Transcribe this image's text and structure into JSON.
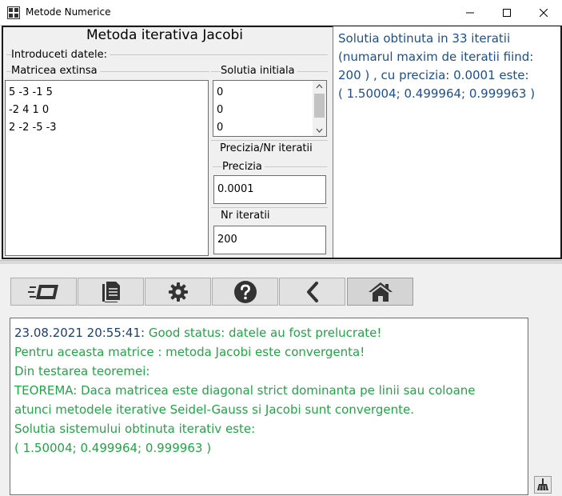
{
  "window": {
    "title": "Metode Numerice",
    "icon": "app-grid-icon"
  },
  "form": {
    "title": "Metoda iterativa Jacobi",
    "intro_label": "Introduceti datele:",
    "matrix_group": "Matricea extinsa",
    "matrix_lines": [
      "5 -3 -1 5",
      "-2 4 1 0",
      "2 -2 -5 -3"
    ],
    "initial_group": "Solutia initiala",
    "initial_values": [
      "0",
      "0",
      "0"
    ],
    "precision_group": "Precizia/Nr iteratii",
    "precision_label": "Precizia",
    "precision_value": "0.0001",
    "iterations_label": "Nr iteratii",
    "iterations_value": "200"
  },
  "result": {
    "lines": [
      "Solutia obtinuta in 33 iteratii",
      "(numarul maxim de iteratii fiind:",
      "200 ) , cu precizia: 0.0001 este:",
      "( 1.50004; 0.499964; 0.999963 )"
    ],
    "color": "#1e4f8c"
  },
  "toolbar": {
    "buttons": [
      "input-card-icon",
      "document-icon",
      "settings-gear-icon",
      "help-icon",
      "back-chevron-icon",
      "home-icon"
    ],
    "selected": "home-icon"
  },
  "log": {
    "timestamp": "23.08.2021 20:55:41:",
    "first_message": " Good status: datele au fost prelucrate!",
    "lines": [
      "Pentru aceasta matrice : metoda Jacobi este convergenta!",
      "Din testarea teoremei:",
      "TEOREMA: Daca matricea este diagonal strict dominanta pe linii sau coloane",
      "atunci metodele iterative Seidel-Gauss si Jacobi sunt convergente.",
      "Solutia sistemului obtinuta iterativ este:",
      "( 1.50004; 0.499964; 0.999963 )"
    ],
    "timestamp_color": "#1e3f6e",
    "message_color": "#22a546"
  },
  "clear_icon": "broom-clear-icon"
}
